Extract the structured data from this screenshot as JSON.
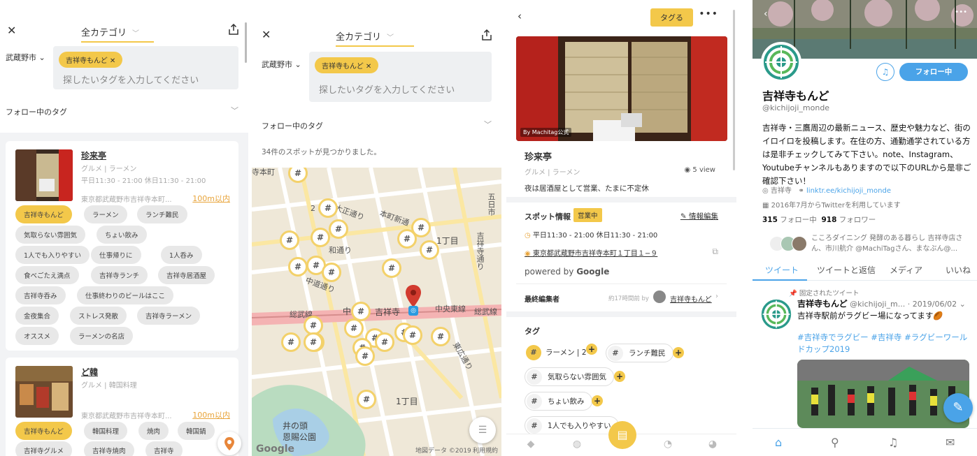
{
  "search": {
    "category": "全カテゴリ",
    "city": "武蔵野市",
    "selected_tag": "吉祥寺もんど",
    "placeholder": "探したいタグを入力してください",
    "follow_tags": "フォロー中のタグ"
  },
  "list": {
    "cards": [
      {
        "name": "珍来亭",
        "genre": "グルメ | ラーメン",
        "hours": "平日11:30 - 21:00 休日11:30 - 21:00",
        "address": "東京都武蔵野市吉祥寺本町...",
        "distance": "100m以内",
        "tags": [
          "吉祥寺もんど",
          "ラーメン",
          "ランチ難民",
          "気取らない雰囲気",
          "ちょい飲み",
          "1人でも入りやすい",
          "仕事帰りに",
          "1人呑み",
          "食べごたえ満点",
          "吉祥寺ランチ",
          "吉祥寺居酒屋",
          "吉祥寺呑み",
          "仕事終わりのビールはここ",
          "金夜集合",
          "ストレス発散",
          "吉祥寺ラーメン",
          "オススメ",
          "ラーメンの名店"
        ]
      },
      {
        "name": "ど韓",
        "genre": "グルメ | 韓国料理",
        "address": "東京都武蔵野市吉祥寺本町...",
        "distance": "100m以内",
        "tags": [
          "吉祥寺もんど",
          "韓国料理",
          "焼肉",
          "韓国鍋",
          "吉祥寺グルメ",
          "吉祥寺焼肉",
          "吉祥寺"
        ]
      }
    ]
  },
  "map": {
    "count_text": "34件のスポットが見つかりました。",
    "labels": {
      "street1": "大正通り",
      "street2": "本町新通",
      "street3": "中道通り",
      "street4": "五日市",
      "street5": "吉祥寺通り",
      "street6": "和通り",
      "block1": "1丁目",
      "block2": "1丁目",
      "line1": "総武線",
      "line2": "中央東線",
      "line3": "総武線",
      "station": "吉祥寺",
      "station_prefix": "中",
      "street7": "東広通り",
      "top_fragment": "寺本町",
      "num": "2",
      "park": "井の頭\n恩賜公園",
      "google": "Google",
      "map_credit": "地図データ ©2019",
      "terms": "利用規約"
    },
    "pin_symbol": "#"
  },
  "detail": {
    "tag_button": "タグる",
    "photo_credit": "By Machitag公式",
    "name": "珍来亭",
    "genre": "グルメ | ラーメン",
    "views": "5 view",
    "note": "夜は居酒屋として営業、たまに不定休",
    "spot_info": "スポット情報",
    "open_badge": "営業中",
    "edit_info": "情報編集",
    "hours": "平日11:30 - 21:00 休日11:30 - 21:00",
    "address": "東京都武蔵野市吉祥寺本町１丁目１−９",
    "powered_by": "powered by",
    "google": "Google",
    "last_editor_label": "最終編集者",
    "last_edit_ago": "約17時間前 by",
    "last_editor": "吉祥寺もんど",
    "tags_header": "タグ",
    "tags": [
      {
        "label": "ラーメン",
        "count": "2",
        "active": true
      },
      {
        "label": "ランチ難民",
        "count": "",
        "active": false
      },
      {
        "label": "気取らない雰囲気",
        "count": "",
        "active": false
      },
      {
        "label": "ちょい飲み",
        "count": "",
        "active": false
      },
      {
        "label": "1人でも入りやすい",
        "count": "",
        "active": false
      }
    ]
  },
  "twitter": {
    "follow_button": "フォロー中",
    "name": "吉祥寺もんど",
    "handle": "@kichijoji_monde",
    "bio": "吉祥寺・三鷹周辺の最新ニュース、歴史や魅力など、街のイロイロを投稿します。在住の方、通勤通学されている方は是非チェックしてみて下さい。note、Instagram、Youtubeチャンネルもありますので以下のURLから是非ご確認下さい！",
    "location": "吉祥寺",
    "link": "linktr.ee/kichijoji_monde",
    "joined": "2016年7月からTwitterを利用しています",
    "following_count": "315",
    "following_label": "フォロー中",
    "followers_count": "918",
    "followers_label": "フォロワー",
    "followed_by": "こころダイニング 発酵のある暮らし 吉祥寺店さん、市川航介 @MachiTagさん、まなぶん@...",
    "tabs": [
      "ツイート",
      "ツイートと返信",
      "メディア",
      "いいね"
    ],
    "pinned_label": "固定されたツイート",
    "tweet": {
      "name": "吉祥寺もんど",
      "handle": "@kichijoji_m...",
      "date": "· 2019/06/02",
      "text": "吉祥寺駅前がラグビー場になってます🏉",
      "hashtags": "#吉祥寺でラグビー #吉祥寺 #ラグビーワールドカップ2019"
    }
  },
  "colors": {
    "accent_yellow": "#f3c84a",
    "twitter_blue": "#4aa3e8",
    "distance_orange": "#e8a43a"
  },
  "icons": {
    "close": "close-icon",
    "share": "share-icon",
    "chevron": "chevron-down-icon",
    "back": "back-icon",
    "more": "more-icon",
    "clock": "clock-icon",
    "location": "location-pin-icon",
    "external": "external-link-icon",
    "list": "list-icon",
    "bell": "bell-icon",
    "compose": "compose-icon"
  }
}
